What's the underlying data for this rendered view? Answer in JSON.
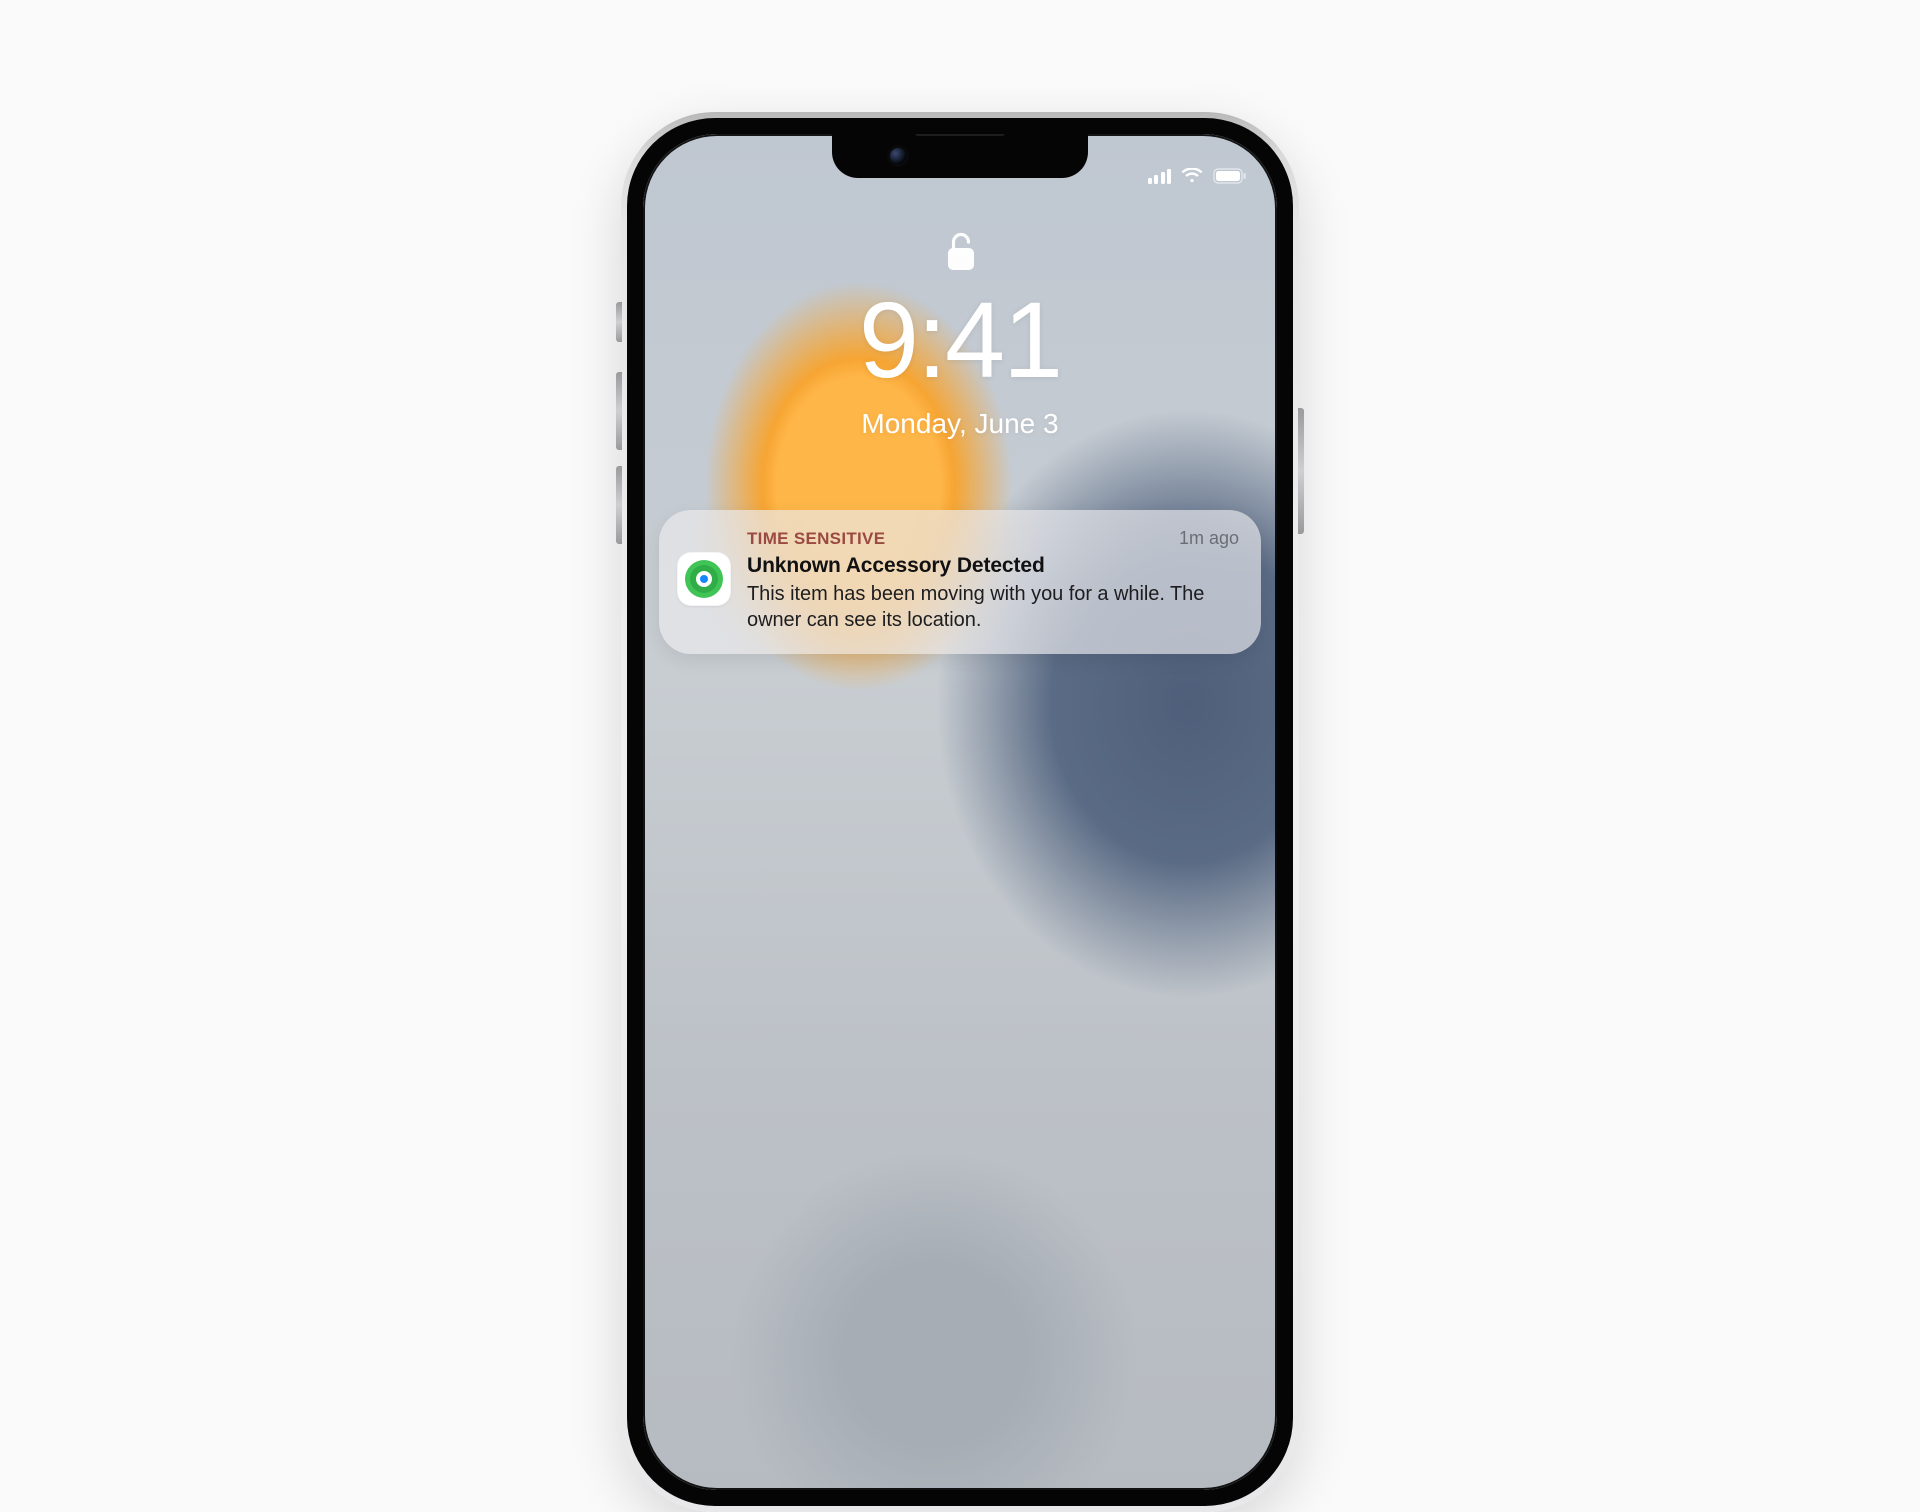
{
  "lockscreen": {
    "time": "9:41",
    "date": "Monday, June 3"
  },
  "statusbar": {
    "cellular_icon": "cellular-icon",
    "wifi_icon": "wifi-icon",
    "battery_icon": "battery-icon"
  },
  "notification": {
    "app_icon": "find-my-icon",
    "eyebrow": "TIME SENSITIVE",
    "timestamp": "1m ago",
    "title": "Unknown Accessory Detected",
    "message": "This item has been moving with you for a while. The owner can see its location."
  }
}
